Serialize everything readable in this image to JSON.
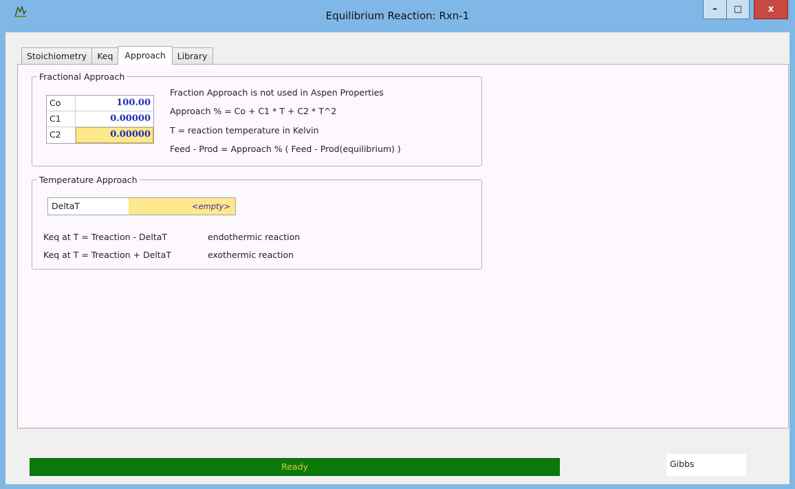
{
  "window": {
    "title": "Equilibrium Reaction: Rxn-1",
    "buttons": {
      "minimize": "–",
      "maximize": "□",
      "close": "x"
    }
  },
  "tabs": [
    {
      "label": "Stoichiometry",
      "active": false
    },
    {
      "label": "Keq",
      "active": false
    },
    {
      "label": "Approach",
      "active": true
    },
    {
      "label": "Library",
      "active": false
    }
  ],
  "fractional_approach": {
    "legend": "Fractional Approach",
    "coefficients": [
      {
        "label": "Co",
        "value": "100.00"
      },
      {
        "label": "C1",
        "value": "0.00000"
      },
      {
        "label": "C2",
        "value": "0.00000"
      }
    ],
    "notes": [
      "Fraction Approach is not used in Aspen Properties",
      "Approach % = Co + C1 * T + C2 * T^2",
      "T = reaction temperature in Kelvin",
      "Feed - Prod = Approach % ( Feed - Prod(equilibrium) )"
    ]
  },
  "temperature_approach": {
    "legend": "Temperature Approach",
    "field_label": "DeltaT",
    "field_value": "<empty>",
    "rows": [
      {
        "formula": "Keq at T = Treaction  - DeltaT",
        "type": "endothermic reaction"
      },
      {
        "formula": "Keq at T = Treaction + DeltaT",
        "type": "exothermic reaction"
      }
    ]
  },
  "status": {
    "progress_text": "Ready",
    "progress_fraction": 1.0,
    "method": "Gibbs"
  },
  "colors": {
    "progress_green": "#0b7a0b",
    "editable_yellow": "#ffe78b",
    "value_blue": "#1f2fb8"
  }
}
